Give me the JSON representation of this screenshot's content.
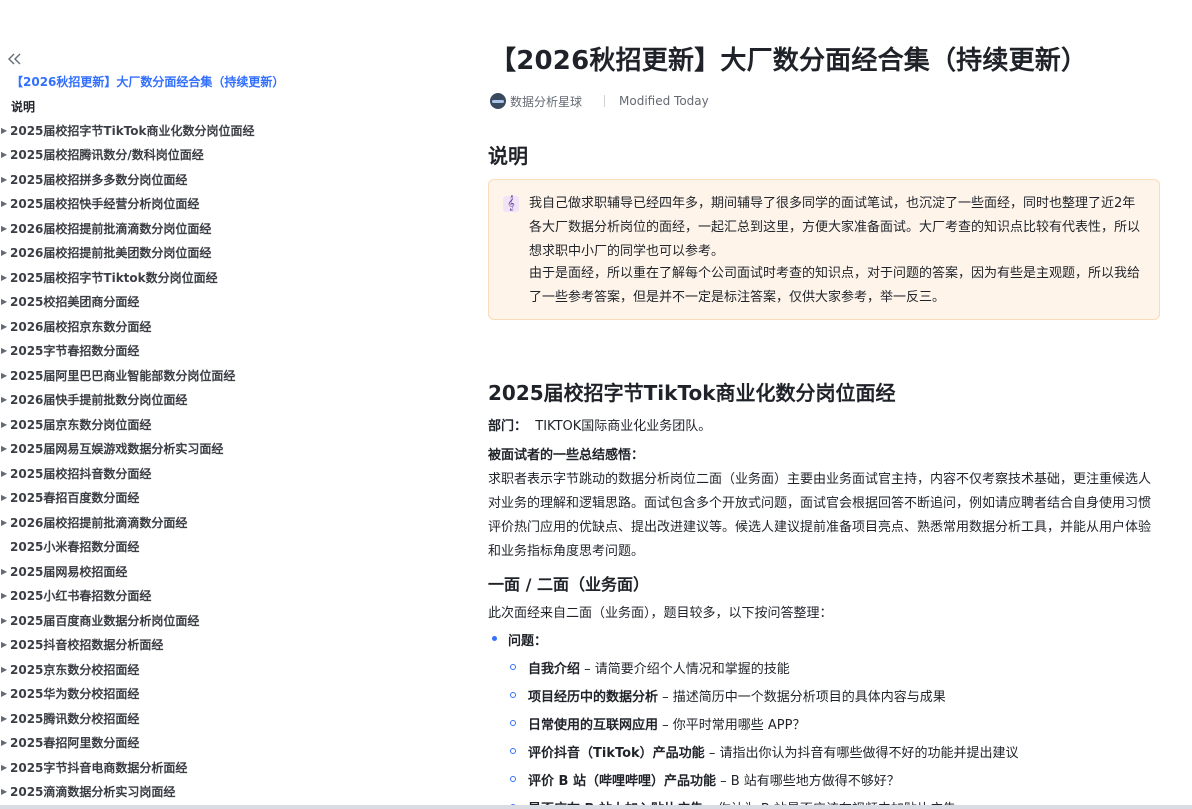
{
  "sidebar": {
    "doc_title": "【2026秋招更新】大厂数分面经合集（持续更新）",
    "intro": "说明",
    "items": [
      {
        "label": "2025届校招字节TikTok商业化数分岗位面经",
        "caret": true
      },
      {
        "label": "2025届校招腾讯数分/数科岗位面经",
        "caret": true
      },
      {
        "label": "2025届校招拼多多数分岗位面经",
        "caret": true
      },
      {
        "label": "2025届校招快手经营分析岗位面经",
        "caret": true
      },
      {
        "label": "2026届校招提前批滴滴数分岗位面经",
        "caret": true
      },
      {
        "label": "2026届校招提前批美团数分岗位面经",
        "caret": true
      },
      {
        "label": "2025届校招字节Tiktok数分岗位面经",
        "caret": true
      },
      {
        "label": "2025校招美团商分面经",
        "caret": true
      },
      {
        "label": "2026届校招京东数分面经",
        "caret": true
      },
      {
        "label": "2025字节春招数分面经",
        "caret": true
      },
      {
        "label": "2025届阿里巴巴商业智能部数分岗位面经",
        "caret": true
      },
      {
        "label": "2026届快手提前批数分岗位面经",
        "caret": true
      },
      {
        "label": "2025届京东数分岗位面经",
        "caret": true
      },
      {
        "label": "2025届网易互娱游戏数据分析实习面经",
        "caret": true
      },
      {
        "label": "2025届校招抖音数分面经",
        "caret": true
      },
      {
        "label": "2025春招百度数分面经",
        "caret": true
      },
      {
        "label": "2026届校招提前批滴滴数分面经",
        "caret": true
      },
      {
        "label": "2025小米春招数分面经",
        "caret": false
      },
      {
        "label": "2025届网易校招面经",
        "caret": true
      },
      {
        "label": "2025小红书春招数分面经",
        "caret": true
      },
      {
        "label": "2025届百度商业数据分析岗位面经",
        "caret": true
      },
      {
        "label": "2025抖音校招数据分析面经",
        "caret": true
      },
      {
        "label": "2025京东数分校招面经",
        "caret": true
      },
      {
        "label": "2025华为数分校招面经",
        "caret": true
      },
      {
        "label": "2025腾讯数分校招面经",
        "caret": true
      },
      {
        "label": "2025春招阿里数分面经",
        "caret": true
      },
      {
        "label": "2025字节抖音电商数据分析面经",
        "caret": true
      },
      {
        "label": "2025滴滴数据分析实习岗面经",
        "caret": true
      }
    ]
  },
  "doc": {
    "title": "【2026秋招更新】大厂数分面经合集（持续更新）",
    "author": "数据分析星球",
    "modified": "Modified Today",
    "h_explain": "说明",
    "callout_p1": "我自己做求职辅导已经四年多，期间辅导了很多同学的面试笔试，也沉淀了一些面经，同时也整理了近2年各大厂数据分析岗位的面经，一起汇总到这里，方便大家准备面试。大厂考查的知识点比较有代表性，所以想求职中小厂的同学也可以参考。",
    "callout_p2": "由于是面经，所以重在了解每个公司面试时考查的知识点，对于问题的答案，因为有些是主观题，所以我给了一些参考答案，但是并不一定是标注答案，仅供大家参考，举一反三。",
    "section_title": "2025届校招字节TikTok商业化数分岗位面经",
    "dept_label": "部门：",
    "dept_value": "TIKTOK国际商业化业务团队。",
    "feelings_label": "被面试者的一些总结感悟：",
    "feelings_para": "求职者表示字节跳动的数据分析岗位二面（业务面）主要由业务面试官主持，内容不仅考察技术基础，更注重候选人对业务的理解和逻辑思路。面试包含多个开放式问题，面试官会根据回答不断追问，例如请应聘者结合自身使用习惯评价热门应用的优缺点、提出改进建议等。候选人建议提前准备项目亮点、熟悉常用数据分析工具，并能从用户体验和业务指标角度思考问题。",
    "round_title": "一面 / 二面（业务面）",
    "round_intro": "此次面经来自二面（业务面），题目较多，以下按问答整理：",
    "questions_label": "问题：",
    "questions": [
      {
        "term": "自我介绍",
        "desc": " – 请简要介绍个人情况和掌握的技能"
      },
      {
        "term": "项目经历中的数据分析",
        "desc": " – 描述简历中一个数据分析项目的具体内容与成果"
      },
      {
        "term": "日常使用的互联网应用",
        "desc": " – 你平时常用哪些 APP？"
      },
      {
        "term": "评价抖音（TikTok）产品功能",
        "desc": " – 请指出你认为抖音有哪些做得不好的功能并提出建议"
      },
      {
        "term": "评价 B 站（哔哩哔哩）产品功能",
        "desc": " – B 站有哪些地方做得不够好？"
      },
      {
        "term": "是否应在 B 站上加入贴片广告",
        "desc": " – 你认为 B 站是否应该在视频中加贴片广告"
      }
    ]
  }
}
